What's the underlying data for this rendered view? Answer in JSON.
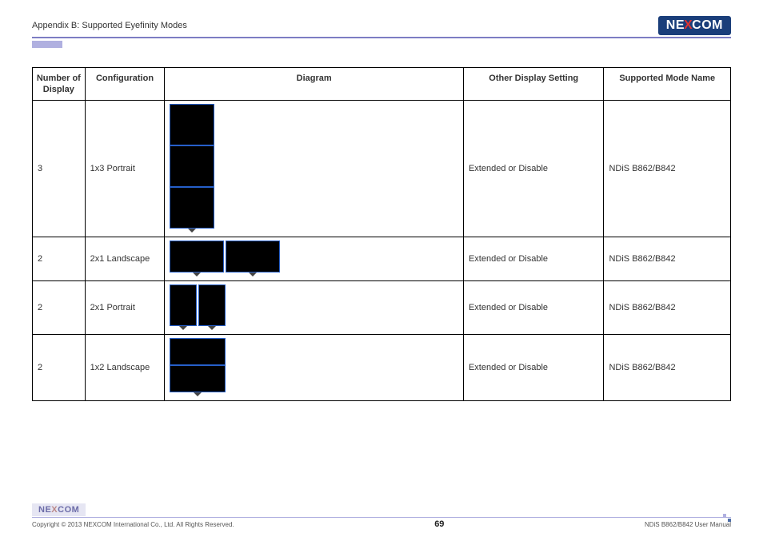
{
  "header": {
    "title": "Appendix B: Supported Eyefinity Modes",
    "logo_pre": "NE",
    "logo_x": "X",
    "logo_post": "COM"
  },
  "table": {
    "headers": {
      "number": "Number of Display",
      "config": "Configuration",
      "diagram": "Diagram",
      "other": "Other Display Setting",
      "name": "Supported Mode Name"
    },
    "rows": [
      {
        "number": "3",
        "config": "1x3 Portrait",
        "other": "Extended or Disable",
        "name": "NDiS B862/B842"
      },
      {
        "number": "2",
        "config": "2x1 Landscape",
        "other": "Extended or Disable",
        "name": "NDiS B862/B842"
      },
      {
        "number": "2",
        "config": "2x1 Portrait",
        "other": "Extended or Disable",
        "name": "NDiS B862/B842"
      },
      {
        "number": "2",
        "config": "1x2 Landscape",
        "other": "Extended or Disable",
        "name": "NDiS B862/B842"
      }
    ]
  },
  "footer": {
    "logo_pre": "NE",
    "logo_x": "X",
    "logo_post": "COM",
    "copyright": "Copyright © 2013 NEXCOM International Co., Ltd. All Rights Reserved.",
    "page": "69",
    "manual": "NDiS B862/B842 User Manual"
  }
}
